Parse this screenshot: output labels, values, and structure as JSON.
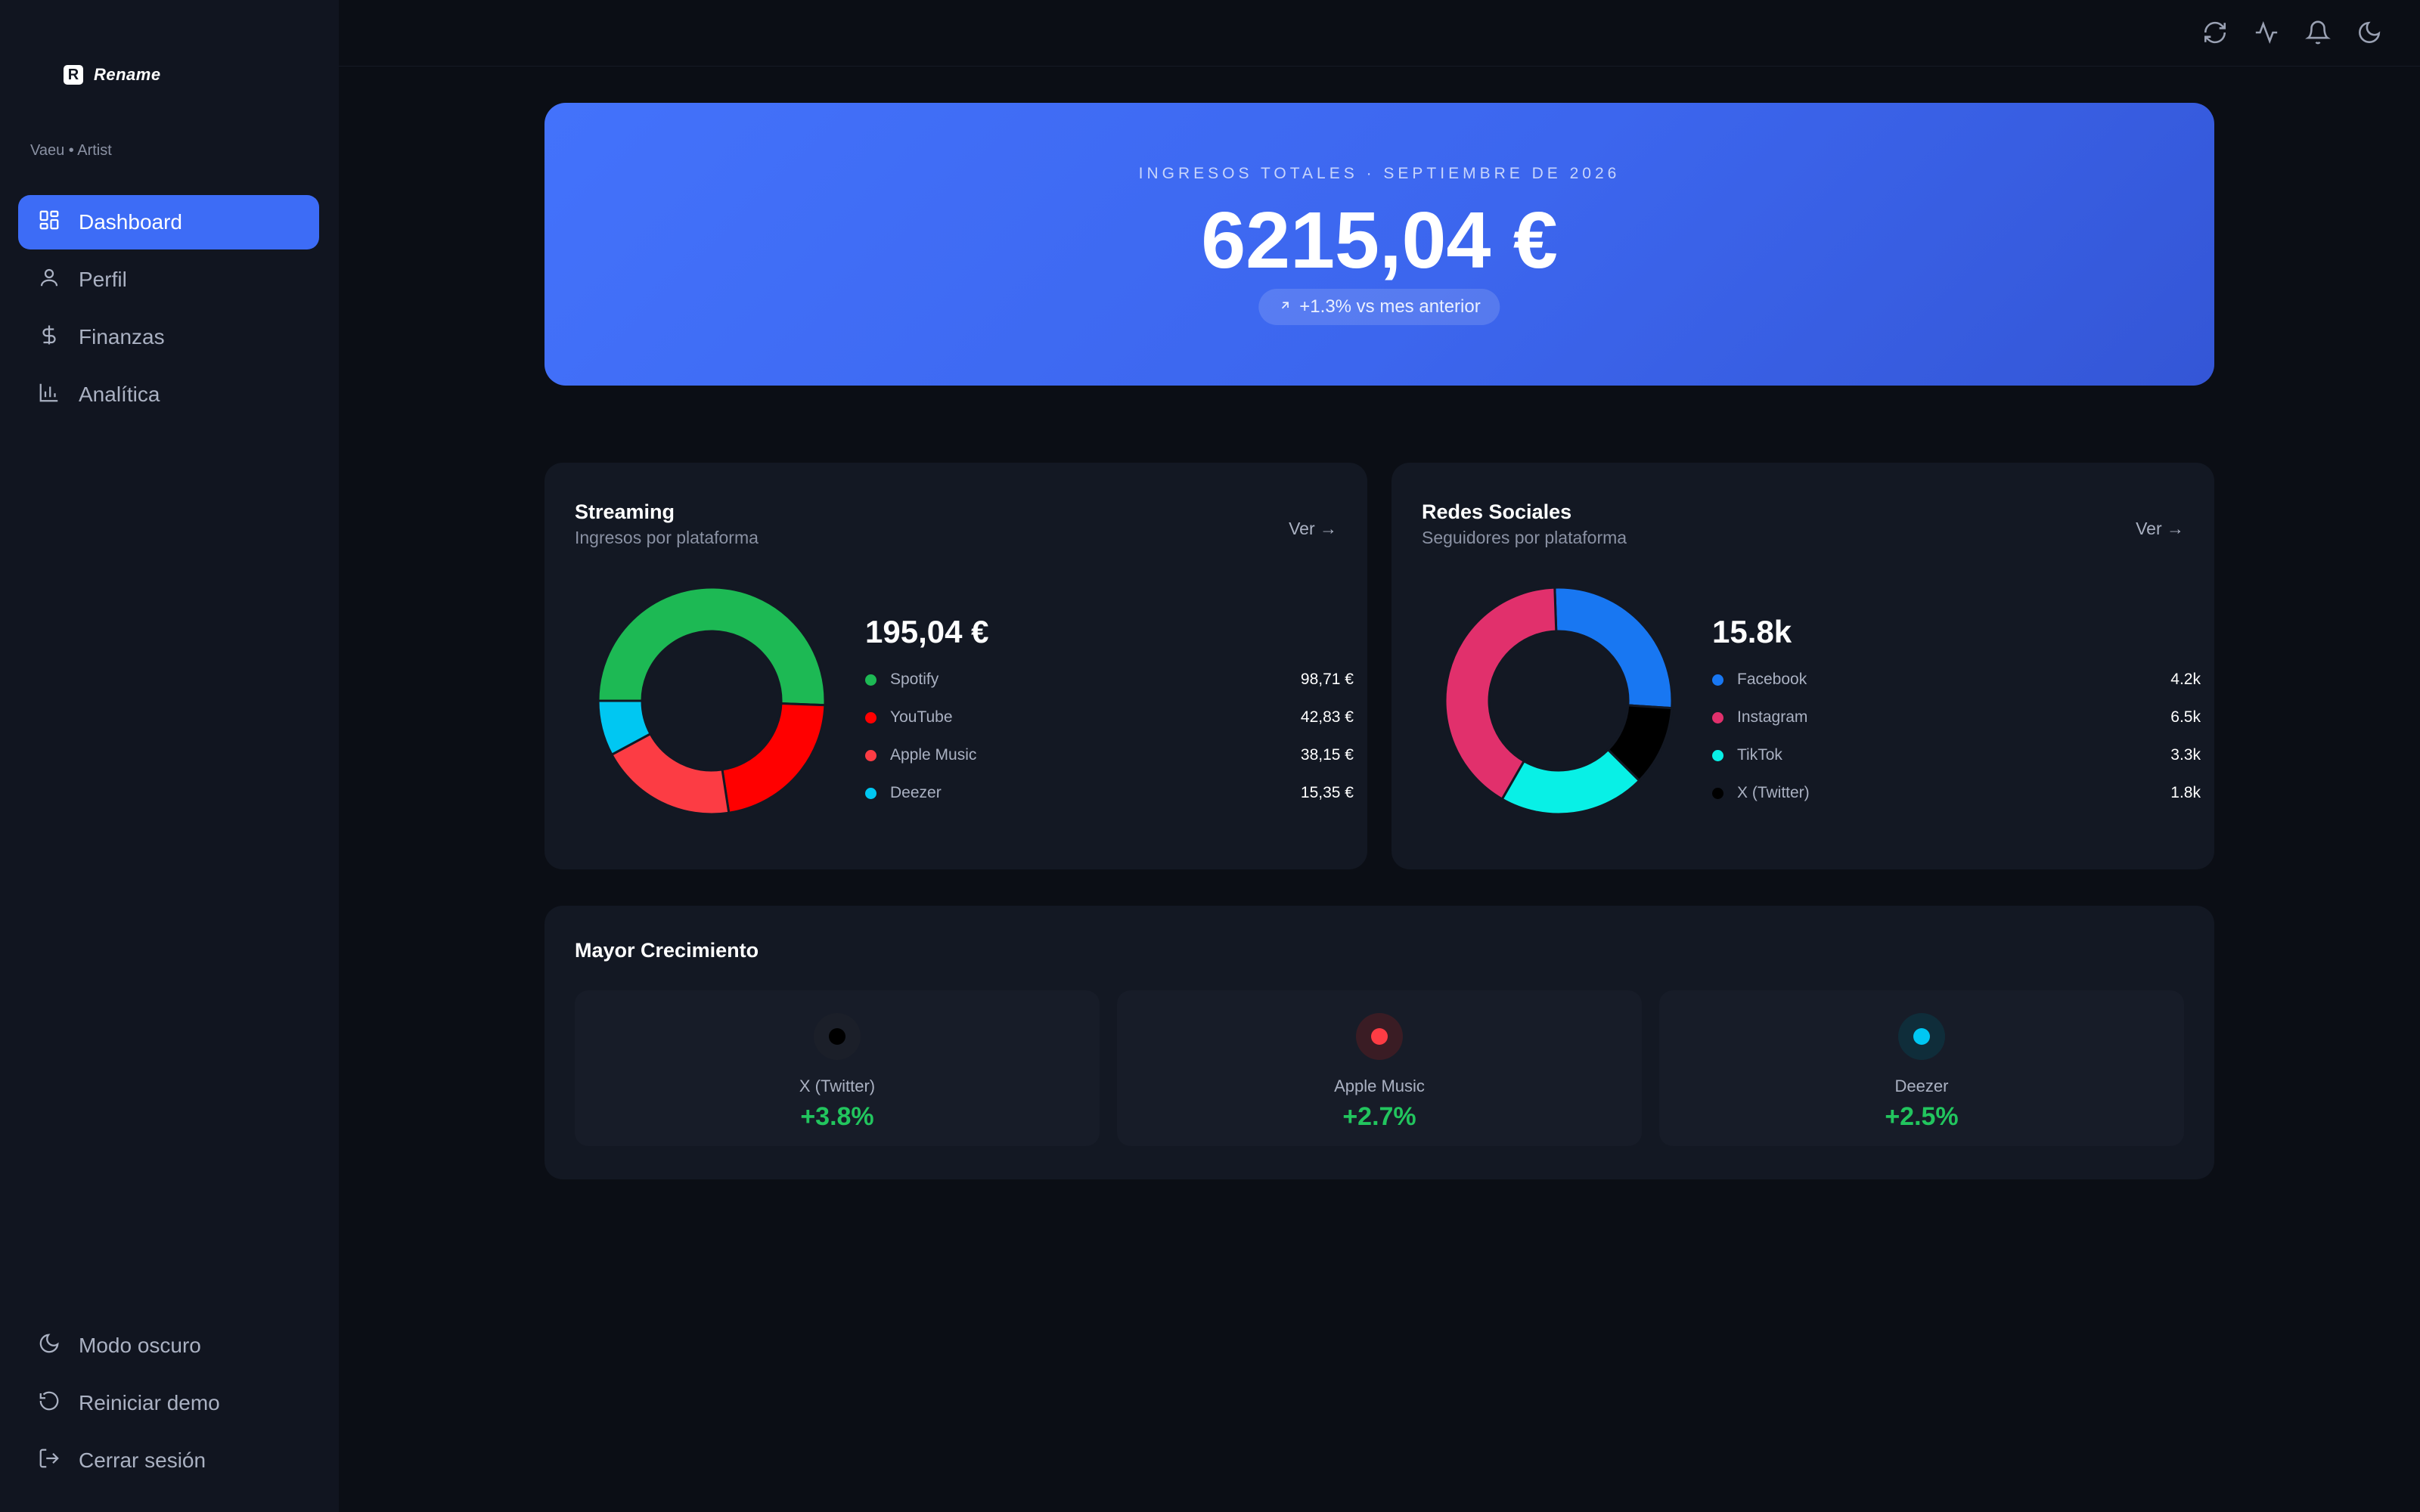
{
  "app": {
    "logo_mark": "R",
    "name": "Rename",
    "user": "Vaeu • Artist"
  },
  "sidebar": {
    "items": [
      {
        "label": "Dashboard",
        "icon": "dashboard-icon",
        "active": true
      },
      {
        "label": "Perfil",
        "icon": "user-icon",
        "active": false
      },
      {
        "label": "Finanzas",
        "icon": "dollar-icon",
        "active": false
      },
      {
        "label": "Analítica",
        "icon": "chart-icon",
        "active": false
      }
    ],
    "bottom": [
      {
        "label": "Modo oscuro",
        "icon": "moon-icon"
      },
      {
        "label": "Reiniciar demo",
        "icon": "reset-icon"
      },
      {
        "label": "Cerrar sesión",
        "icon": "logout-icon"
      }
    ]
  },
  "topbar": {
    "icons": [
      "refresh-icon",
      "activity-icon",
      "bell-icon",
      "moon-icon"
    ]
  },
  "hero": {
    "label": "INGRESOS TOTALES · SEPTIEMBRE DE 2026",
    "amount": "6215,04 €",
    "change": "+1.3% vs mes anterior"
  },
  "colors": {
    "accent": "#3d6cf6",
    "positive": "#22c55e",
    "background": "#0b0e15",
    "card": "#131823"
  },
  "streaming": {
    "title": "Streaming",
    "subtitle": "Ingresos por plataforma",
    "link": "Ver →",
    "total": "195,04 €",
    "items": [
      {
        "name": "Spotify",
        "value": "98,71 €",
        "color": "#1db954"
      },
      {
        "name": "YouTube",
        "value": "42,83 €",
        "color": "#ff0000"
      },
      {
        "name": "Apple Music",
        "value": "38,15 €",
        "color": "#fc3c44"
      },
      {
        "name": "Deezer",
        "value": "15,35 €",
        "color": "#00c7f2"
      }
    ]
  },
  "social": {
    "title": "Redes Sociales",
    "subtitle": "Seguidores por plataforma",
    "link": "Ver →",
    "total": "15.8k",
    "items": [
      {
        "name": "Facebook",
        "value": "4.2k",
        "color": "#1877f2"
      },
      {
        "name": "Instagram",
        "value": "6.5k",
        "color": "#e1306c"
      },
      {
        "name": "TikTok",
        "value": "3.3k",
        "color": "#08f0e6"
      },
      {
        "name": "X (Twitter)",
        "value": "1.8k",
        "color": "#000000"
      }
    ]
  },
  "chart_data": [
    {
      "type": "pie",
      "categories": [
        "Spotify",
        "YouTube",
        "Apple Music",
        "Deezer"
      ],
      "values": [
        98.71,
        42.83,
        38.15,
        15.35
      ],
      "colors": [
        "#1db954",
        "#ff0000",
        "#fc3c44",
        "#00c7f2"
      ],
      "order": "clockwise from 9 o'clock"
    },
    {
      "type": "pie",
      "categories": [
        "Facebook",
        "X (Twitter)",
        "TikTok",
        "Instagram"
      ],
      "values": [
        4.2,
        1.8,
        3.3,
        6.5
      ],
      "colors": [
        "#1877f2",
        "#000000",
        "#08f0e6",
        "#e1306c"
      ],
      "order": "clockwise from 12 o'clock"
    }
  ],
  "growth": {
    "title": "Mayor Crecimiento",
    "items": [
      {
        "name": "X (Twitter)",
        "value": "+3.8%",
        "color": "#000000",
        "bg": "#1b1f29"
      },
      {
        "name": "Apple Music",
        "value": "+2.7%",
        "color": "#fc3c44",
        "bg": "#3a1c24"
      },
      {
        "name": "Deezer",
        "value": "+2.5%",
        "color": "#00c7f2",
        "bg": "#0f2d3a"
      }
    ]
  }
}
